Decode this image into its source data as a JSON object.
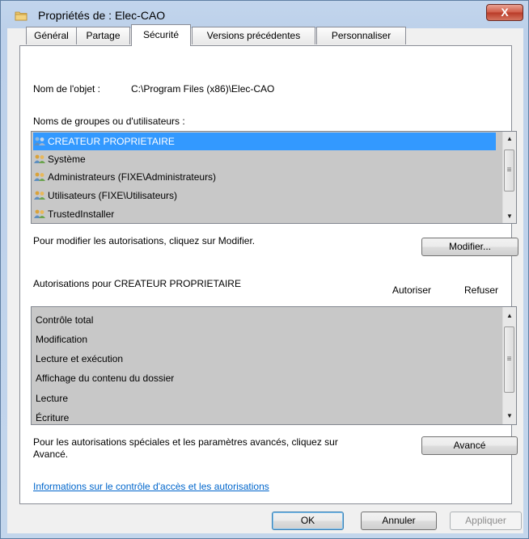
{
  "window": {
    "title": "Propriétés de : Elec-CAO",
    "close_label": "X"
  },
  "tabs": [
    {
      "label": "Général"
    },
    {
      "label": "Partage"
    },
    {
      "label": "Sécurité"
    },
    {
      "label": "Versions précédentes"
    },
    {
      "label": "Personnaliser"
    }
  ],
  "security": {
    "object_name_label": "Nom de l'objet :",
    "object_name_value": "C:\\Program Files (x86)\\Elec-CAO",
    "groups_label": "Noms de groupes ou d'utilisateurs :",
    "groups": [
      {
        "name": "CREATEUR PROPRIETAIRE",
        "selected": true
      },
      {
        "name": "Système"
      },
      {
        "name": "Administrateurs (FIXE\\Administrateurs)"
      },
      {
        "name": "Utilisateurs (FIXE\\Utilisateurs)"
      },
      {
        "name": "TrustedInstaller"
      }
    ],
    "modify_hint": "Pour modifier les autorisations, cliquez sur Modifier.",
    "modify_button": "Modifier...",
    "permissions_label": "Autorisations pour CREATEUR PROPRIETAIRE",
    "allow_header": "Autoriser",
    "deny_header": "Refuser",
    "permissions": [
      {
        "name": "Contrôle total"
      },
      {
        "name": "Modification"
      },
      {
        "name": "Lecture et exécution"
      },
      {
        "name": "Affichage du contenu du dossier"
      },
      {
        "name": "Lecture"
      },
      {
        "name": "Écriture"
      }
    ],
    "advanced_hint_line1": "Pour les autorisations spéciales et les paramètres avancés, cliquez sur",
    "advanced_hint_line2": "Avancé.",
    "advanced_button": "Avancé",
    "info_link": "Informations sur le contrôle d'accès et les autorisations"
  },
  "footer": {
    "ok": "OK",
    "cancel": "Annuler",
    "apply": "Appliquer"
  },
  "colors": {
    "selection": "#3399ff",
    "link": "#0066cc",
    "close": "#c9483a"
  }
}
